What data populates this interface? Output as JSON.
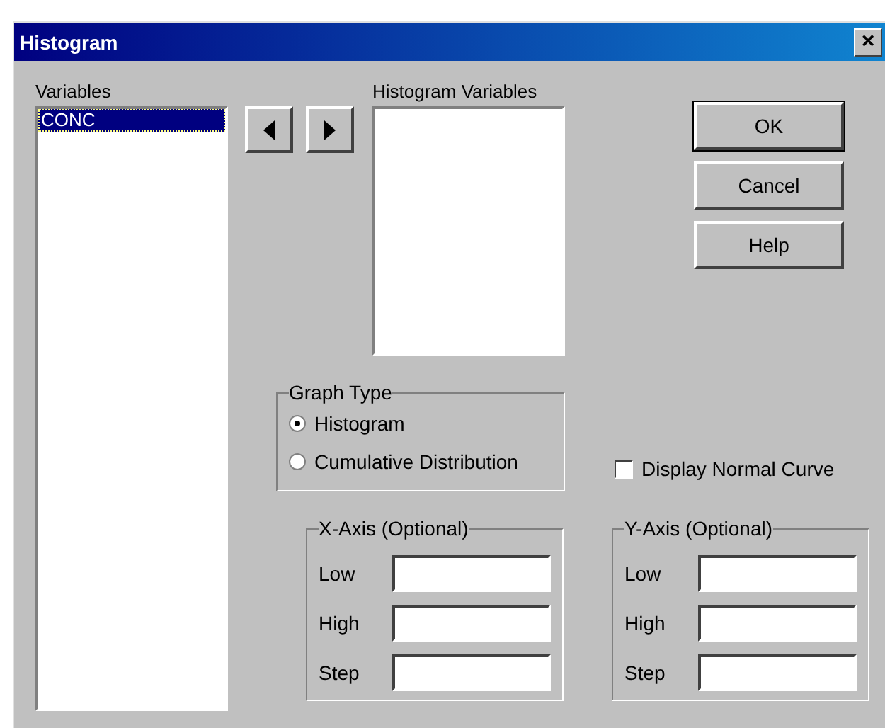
{
  "window": {
    "title": "Histogram",
    "close": "×"
  },
  "variables": {
    "label": "Variables",
    "items": [
      {
        "label": "CONC",
        "selected": true
      }
    ]
  },
  "move_buttons": [
    {
      "kind": "left"
    },
    {
      "kind": "right"
    }
  ],
  "histogram_variables": {
    "label": "Histogram Variables"
  },
  "buttons": [
    {
      "label": "OK",
      "default": true
    },
    {
      "label": "Cancel",
      "default": false
    },
    {
      "label": "Help",
      "default": false
    }
  ],
  "graph_type": {
    "label": "Graph Type",
    "options": [
      {
        "label": "Histogram",
        "selected": true
      },
      {
        "label": "Cumulative Distribution",
        "selected": false
      }
    ]
  },
  "display_normal_curve": {
    "label": "Display Normal Curve",
    "checked": false
  },
  "axes": [
    {
      "label": "X-Axis (Optional)",
      "fields": [
        "Low",
        "High",
        "Step"
      ]
    },
    {
      "label": "Y-Axis (Optional)",
      "fields": [
        "Low",
        "High",
        "Step"
      ]
    }
  ]
}
